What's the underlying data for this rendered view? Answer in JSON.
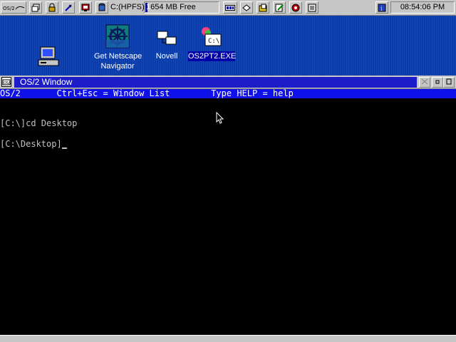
{
  "taskbar": {
    "drive_label": "C:(HPFS)",
    "drive_free_prefix": "1",
    "drive_free_rest": "654 MB Free",
    "drive_free_fraction": 0.03,
    "clock": "08:54:06 PM",
    "icons": [
      "os2-menu-icon",
      "window-list-icon",
      "lock-icon",
      "plug-icon",
      "cpu-monitor-icon",
      "disk-icon",
      "process-icon",
      "drive-icon",
      "folder-icon",
      "note-icon",
      "shutdown-icon",
      "help-icon"
    ]
  },
  "desktop": {
    "icons": [
      {
        "label": "Get Netscape\nNavigator",
        "line1": "Get Netscape",
        "line2": "Navigator"
      },
      {
        "label": "Novell"
      },
      {
        "label": "OS2PT2.EXE"
      }
    ]
  },
  "window": {
    "title": "OS/2 Window",
    "header_line": "OS/2       Ctrl+Esc = Window List        Type HELP = help",
    "lines": [
      "[C:\\]cd Desktop",
      "[C:\\Desktop]"
    ]
  },
  "colors": {
    "desktop": "#0a3fb4",
    "title_bar": "#1c1cc8",
    "console_bg": "#000000",
    "console_header": "#1010e8"
  }
}
